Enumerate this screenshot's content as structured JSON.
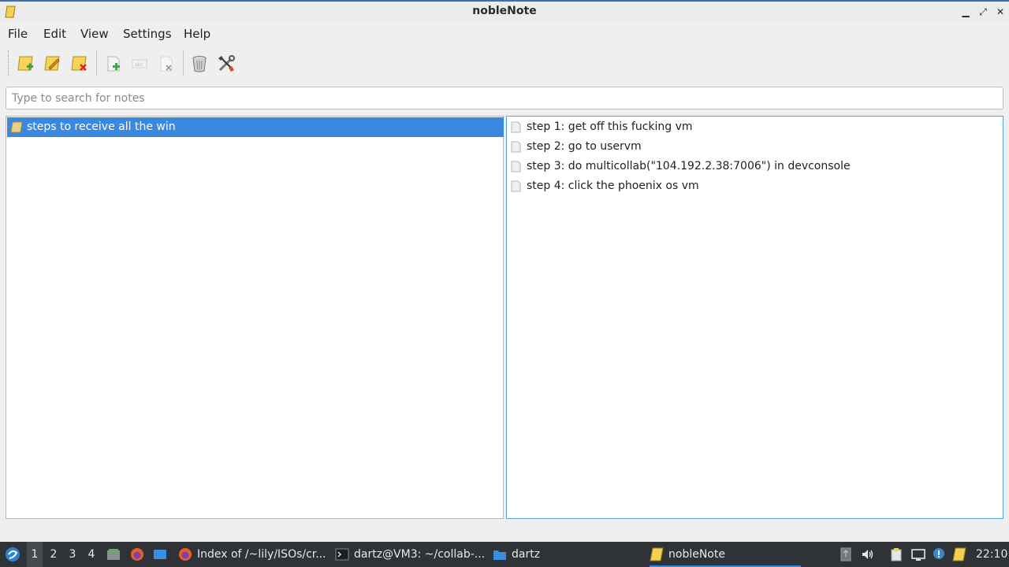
{
  "window": {
    "title": "nobleNote"
  },
  "menu": [
    "File",
    "Edit",
    "View",
    "Settings",
    "Help"
  ],
  "toolbar": {
    "buttons": [
      {
        "name": "new-notebook",
        "enabled": true
      },
      {
        "name": "rename-notebook",
        "enabled": true
      },
      {
        "name": "delete-notebook",
        "enabled": true
      },
      {
        "name": "new-note",
        "enabled": true
      },
      {
        "name": "rename-note",
        "enabled": false
      },
      {
        "name": "delete-note",
        "enabled": false
      },
      {
        "name": "trash",
        "enabled": true
      },
      {
        "name": "settings",
        "enabled": true
      }
    ]
  },
  "search": {
    "placeholder": "Type to search for notes",
    "value": ""
  },
  "notebooks": [
    {
      "label": "steps to receive all the win",
      "selected": true
    }
  ],
  "notes": [
    {
      "label": "step 1: get off this fucking vm"
    },
    {
      "label": "step 2: go to uservm"
    },
    {
      "label": "step 3: do multicollab(\"104.192.2.38:7006\") in devconsole"
    },
    {
      "label": "step 4: click the phoenix os vm"
    }
  ],
  "taskbar": {
    "workspaces": [
      "1",
      "2",
      "3",
      "4"
    ],
    "active_workspace": "1",
    "tasks": [
      {
        "label": "Index of /~lily/ISOs/cr...",
        "icon": "firefox-icon"
      },
      {
        "label": "dartz@VM3: ~/collab-...",
        "icon": "terminal-icon"
      },
      {
        "label": "dartz",
        "icon": "folder-icon"
      },
      {
        "label": "nobleNote",
        "icon": "noblenote-icon",
        "active": true
      }
    ],
    "clock": "22:10"
  }
}
